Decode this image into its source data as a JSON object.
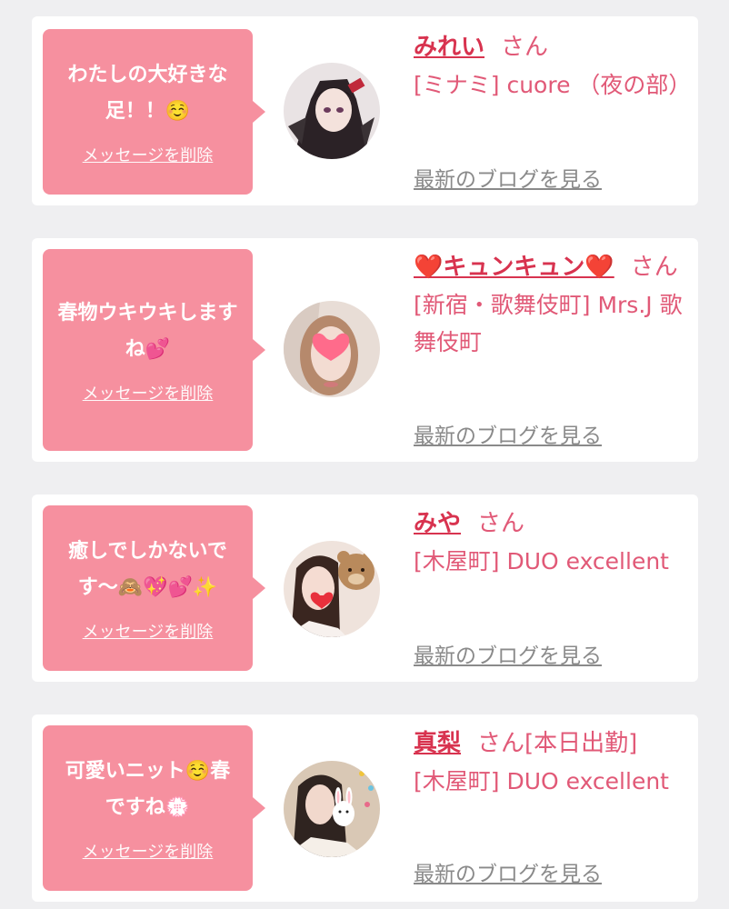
{
  "colors": {
    "background": "#efeff1",
    "bubble": "#f6909f",
    "name": "#d8334f",
    "shop": "#e15977",
    "link_gray": "#8a8a8a"
  },
  "delete_label": "メッセージを削除",
  "blog_label": "最新のブログを見る",
  "cards": [
    {
      "message": "わたしの大好きな足！！☺️",
      "name": "みれい",
      "honorific": "さん",
      "shop": "[ミナミ] cuore （夜の部）"
    },
    {
      "message": "春物ウキウキしますね💕",
      "name": "❤️キュンキュン❤️",
      "honorific": "さん",
      "shop": "[新宿・歌舞伎町] Mrs.J 歌舞伎町"
    },
    {
      "message": "癒しでしかないです〜🙈💖💕✨",
      "name": "みや",
      "honorific": "さん",
      "shop": "[木屋町] DUO excellent"
    },
    {
      "message": "可愛いニット☺️春ですね💮",
      "name": "真梨",
      "honorific": "さん[本日出勤]",
      "shop": "[木屋町] DUO excellent"
    }
  ]
}
